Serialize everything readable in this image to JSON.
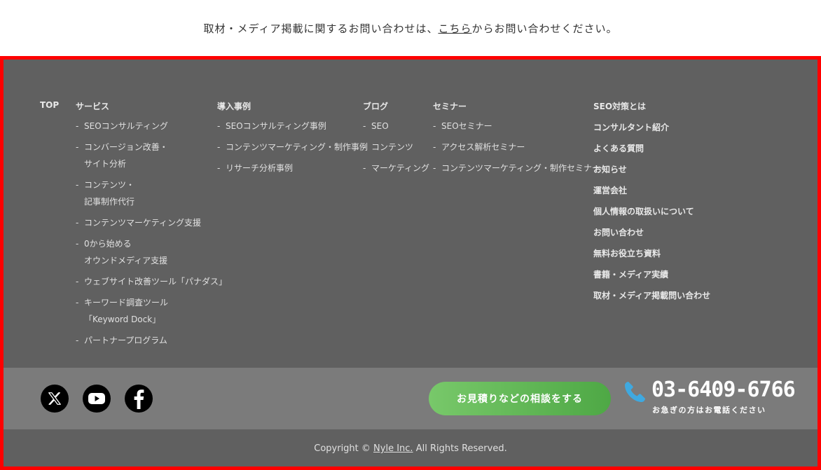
{
  "notice": {
    "prefix": "取材・メディア掲載に関するお問い合わせは、",
    "link": "こちら",
    "suffix": "からお問い合わせください。"
  },
  "nav": {
    "top_label": "TOP",
    "services": {
      "heading": "サービス",
      "items": [
        [
          "SEOコンサルティング"
        ],
        [
          "コンバージョン改善・",
          "サイト分析"
        ],
        [
          "コンテンツ・",
          "記事制作代行"
        ],
        [
          "コンテンツマーケティング支援"
        ],
        [
          "0から始める",
          "オウンドメディア支援"
        ],
        [
          "ウェブサイト改善ツール「パナダス」"
        ],
        [
          "キーワード調査ツール",
          "「Keyword Dock」"
        ],
        [
          "パートナープログラム"
        ]
      ]
    },
    "cases": {
      "heading": "導入事例",
      "items": [
        "SEOコンサルティング事例",
        "コンテンツマーケティング・制作事例",
        "リサーチ分析事例"
      ]
    },
    "blog": {
      "heading": "ブログ",
      "items": [
        "SEO",
        "コンテンツ",
        "マーケティング"
      ]
    },
    "seminar": {
      "heading": "セミナー",
      "items": [
        "SEOセミナー",
        "アクセス解析セミナー",
        "コンテンツマーケティング・制作セミナー"
      ]
    },
    "right_links": [
      "SEO対策とは",
      "コンサルタント紹介",
      "よくある質問",
      "お知らせ",
      "運営会社",
      "個人情報の取扱いについて",
      "お問い合わせ",
      "無料お役立ち資料",
      "書籍・メディア実績",
      "取材・メディア掲載問い合わせ"
    ]
  },
  "bar": {
    "social_icons": [
      "x-icon",
      "youtube-icon",
      "facebook-icon"
    ],
    "cta_label": "お見積りなどの相談をする",
    "phone_number": "03-6409-6766",
    "phone_caption": "お急ぎの方はお電話ください"
  },
  "copyright": {
    "prefix": "Copyright © ",
    "link": "Nyle Inc.",
    "suffix": " All Rights Reserved."
  },
  "colors": {
    "footer_bg": "#606060",
    "bar_bg": "#7b7b7b",
    "border": "#ff0000",
    "cta_start": "#78c86a",
    "cta_end": "#4ea845",
    "phone_icon": "#3fa9e0"
  }
}
